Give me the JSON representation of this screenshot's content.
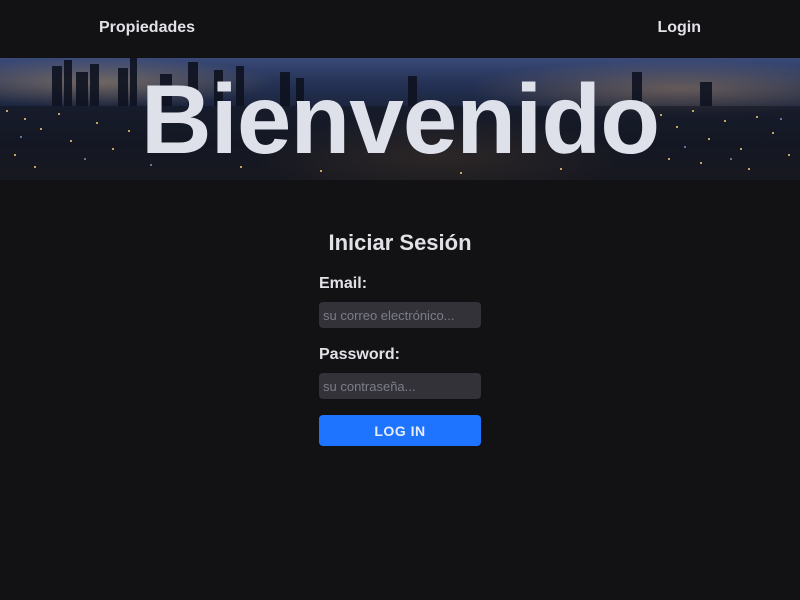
{
  "nav": {
    "left_link": "Propiedades",
    "right_link": "Login"
  },
  "hero": {
    "title": "Bienvenido"
  },
  "login": {
    "title": "Iniciar Sesión",
    "email_label": "Email:",
    "email_placeholder": "su correo electrónico...",
    "password_label": "Password:",
    "password_placeholder": "su contraseña...",
    "button_label": "LOG IN"
  },
  "colors": {
    "background": "#121214",
    "input_bg": "#323238",
    "button": "#1f74ff",
    "text": "#e1e1e6"
  }
}
